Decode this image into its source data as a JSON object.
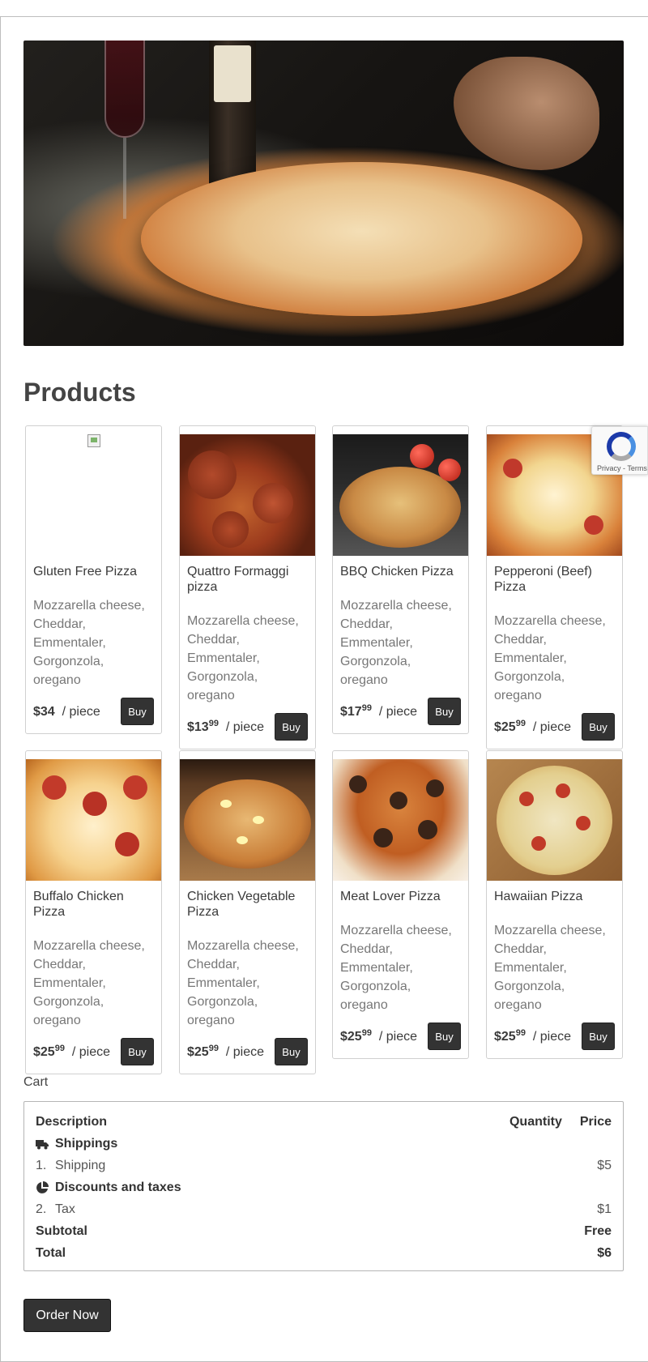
{
  "hero": {
    "image": "pizza-hero-photo"
  },
  "products_heading": "Products",
  "products": [
    {
      "name": "Gluten Free Pizza",
      "description": "Mozzarella cheese, Cheddar, Emmentaler, Gorgonzola, oregano",
      "price_main": "$34",
      "price_cents": "",
      "unit": "/ piece",
      "buy_label": "Buy",
      "image": "broken-image"
    },
    {
      "name": "Quattro Formaggi pizza",
      "description": "Mozzarella cheese, Cheddar, Emmentaler, Gorgonzola, oregano",
      "price_main": "$13",
      "price_cents": "99",
      "unit": "/ piece",
      "buy_label": "Buy",
      "image": "pepperoni-slices-photo"
    },
    {
      "name": "BBQ Chicken Pizza",
      "description": "Mozzarella cheese, Cheddar, Emmentaler, Gorgonzola, oregano",
      "price_main": "$17",
      "price_cents": "99",
      "unit": "/ piece",
      "buy_label": "Buy",
      "image": "olive-tomato-pizza-photo"
    },
    {
      "name": "Pepperoni (Beef) Pizza",
      "description": "Mozzarella cheese, Cheddar, Emmentaler, Gorgonzola, oregano",
      "price_main": "$25",
      "price_cents": "99",
      "unit": "/ piece",
      "buy_label": "Buy",
      "image": "cheese-pizza-photo"
    },
    {
      "name": "Buffalo Chicken Pizza",
      "description": "Mozzarella cheese, Cheddar, Emmentaler, Gorgonzola, oregano",
      "price_main": "$25",
      "price_cents": "99",
      "unit": "/ piece",
      "buy_label": "Buy",
      "image": "salami-pizza-photo"
    },
    {
      "name": "Chicken Vegetable Pizza",
      "description": "Mozzarella cheese, Cheddar, Emmentaler, Gorgonzola, oregano",
      "price_main": "$25",
      "price_cents": "99",
      "unit": "/ piece",
      "buy_label": "Buy",
      "image": "egg-pizza-photo"
    },
    {
      "name": "Meat Lover Pizza",
      "description": "Mozzarella cheese, Cheddar, Emmentaler, Gorgonzola, oregano",
      "price_main": "$25",
      "price_cents": "99",
      "unit": "/ piece",
      "buy_label": "Buy",
      "image": "mushroom-pizza-photo"
    },
    {
      "name": "Hawaiian Pizza",
      "description": "Mozzarella cheese, Cheddar, Emmentaler, Gorgonzola, oregano",
      "price_main": "$25",
      "price_cents": "99",
      "unit": "/ piece",
      "buy_label": "Buy",
      "image": "tomato-slice-pizza-photo"
    }
  ],
  "recaptcha": {
    "text": "Privacy - Terms",
    "icon": "recaptcha-logo"
  },
  "cart": {
    "label": "Cart",
    "header": {
      "description": "Description",
      "quantity": "Quantity",
      "price": "Price"
    },
    "group_shipping": {
      "label": "Shippings",
      "icon": "truck-icon"
    },
    "item_shipping": {
      "index": "1.",
      "label": "Shipping",
      "price": "$5"
    },
    "group_discounts": {
      "label": "Discounts and taxes",
      "icon": "pie-chart-icon"
    },
    "item_tax": {
      "index": "2.",
      "label": "Tax",
      "price": "$1"
    },
    "subtotal": {
      "label": "Subtotal",
      "value": "Free"
    },
    "total": {
      "label": "Total",
      "value": "$6"
    }
  },
  "order_button": "Order Now"
}
